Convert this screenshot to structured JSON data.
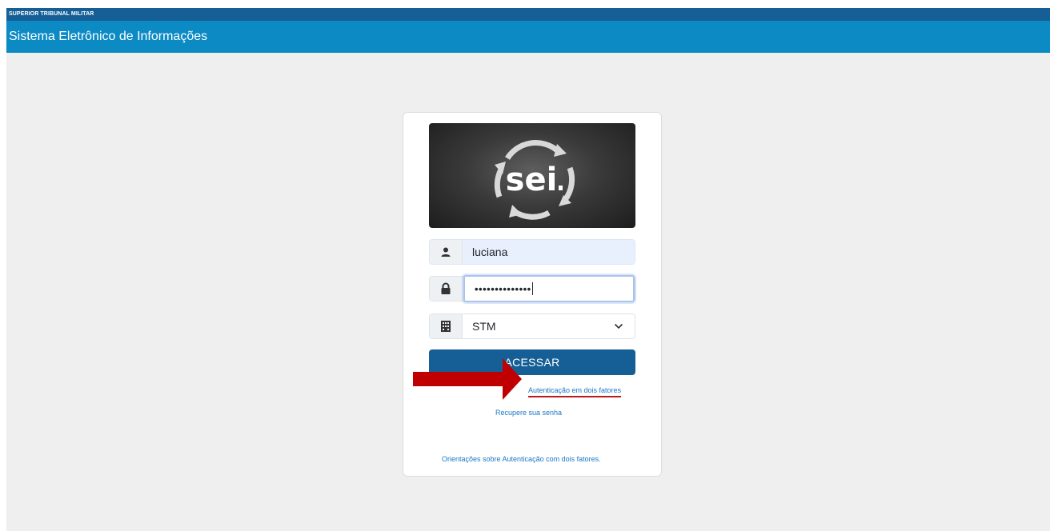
{
  "header": {
    "org_name": "SUPERIOR TRIBUNAL MILITAR",
    "system_title": "Sistema Eletrônico de Informações"
  },
  "login": {
    "logo_text": "sei",
    "username_value": "luciana",
    "password_masked": "••••••••••••••",
    "organization_value": "STM",
    "submit_label": "ACESSAR",
    "two_factor_link": "Autenticação em dois fatores",
    "recover_link": "Recupere sua senha",
    "guidance_link": "Orientações sobre Autenticação com dois fatores."
  },
  "icons": {
    "user": "user-icon",
    "lock": "lock-icon",
    "building": "building-icon",
    "chevron": "chevron-down-icon"
  },
  "colors": {
    "org_bar": "#155f96",
    "system_bar": "#0b8ac4",
    "primary_button": "#155f96",
    "link": "#1b77c6",
    "annotation_arrow": "#c00000"
  }
}
